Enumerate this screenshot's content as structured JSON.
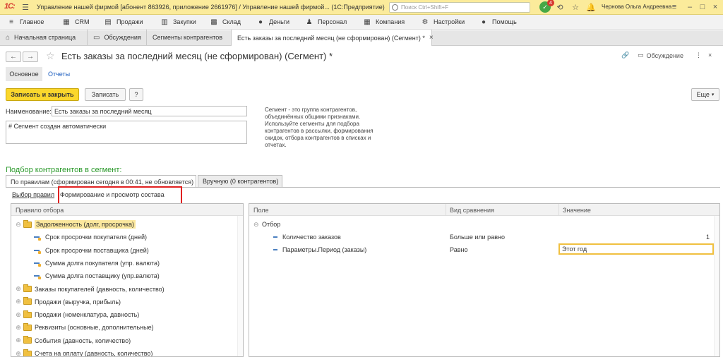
{
  "titlebar": {
    "logo": "1С:",
    "title": "Управление нашей фирмой [абонент 863926, приложение 2661976] / Управление нашей фирмой... (1С:Предприятие)",
    "search_placeholder": "Поиск Ctrl+Shift+F",
    "notif_count": "4",
    "user": "Чернова Ольга Андреевна"
  },
  "menu": [
    "Главное",
    "CRM",
    "Продажи",
    "Закупки",
    "Склад",
    "Деньги",
    "Персонал",
    "Компания",
    "Настройки",
    "Помощь"
  ],
  "tabs": [
    "Начальная страница",
    "Обсуждения",
    "Сегменты контрагентов",
    "Есть заказы за последний месяц (не сформирован) (Сегмент) *"
  ],
  "form": {
    "title": "Есть заказы за последний месяц (не сформирован) (Сегмент) *",
    "discussion": "Обсуждение",
    "nav_main": "Основное",
    "nav_reports": "Отчеты",
    "btn_save_close": "Записать и закрыть",
    "btn_save": "Записать",
    "btn_help": "?",
    "btn_more": "Еще",
    "name_label": "Наименование:",
    "name_value": "Есть заказы за последний месяц",
    "comment_value": "# Сегмент создан автоматически",
    "description": "Сегмент - это группа контрагентов, объединённых общими признаками. Используйте сегменты для подбора контрагентов в рассылки, формирования скидок, отбора контрагентов в списках и отчетах.",
    "section_title": "Подбор контрагентов в сегмент:",
    "tab_rules": "По правилам (сформирован сегодня в 00:41, не обновляется)",
    "tab_manual": "Вручную (0 контрагентов)",
    "sub_rules": "Выбор правил",
    "sub_compose": "Формирование и просмотр состава"
  },
  "left_panel": {
    "header": "Правило отбора",
    "rows": [
      {
        "type": "group",
        "text": "Задолженность (долг, просрочка)",
        "expanded": true,
        "selected": true
      },
      {
        "type": "field",
        "text": "Срок просрочки покупателя (дней)"
      },
      {
        "type": "field",
        "text": "Срок просрочки поставщика (дней)"
      },
      {
        "type": "field",
        "text": "Сумма долга покупателя (упр. валюта)"
      },
      {
        "type": "field",
        "text": "Сумма долга поставщику (упр.валюта)"
      },
      {
        "type": "group",
        "text": "Заказы покупателей (давность, количество)"
      },
      {
        "type": "group",
        "text": "Продажи (выручка, прибыль)"
      },
      {
        "type": "group",
        "text": "Продажи (номенклатура, давность)"
      },
      {
        "type": "group",
        "text": "Реквизиты (основные, дополнительные)"
      },
      {
        "type": "group",
        "text": "События (давность, количество)"
      },
      {
        "type": "group",
        "text": "Счета на оплату (давность, количество)"
      }
    ]
  },
  "right_panel": {
    "col_field": "Поле",
    "col_compare": "Вид сравнения",
    "col_value": "Значение",
    "group": "Отбор",
    "rows": [
      {
        "field": "Количество заказов",
        "compare": "Больше или равно",
        "value": "1"
      },
      {
        "field": "Параметры.Период (заказы)",
        "compare": "Равно",
        "value": "Этот год"
      }
    ]
  }
}
